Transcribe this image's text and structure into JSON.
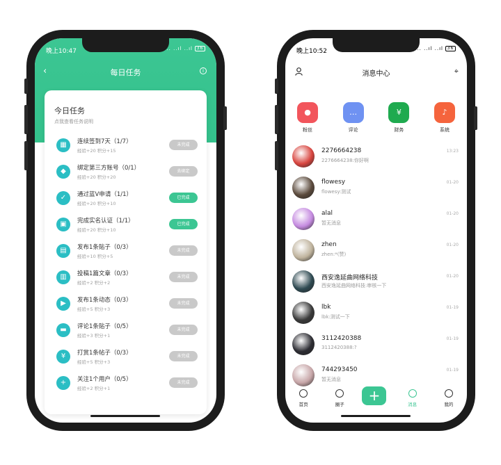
{
  "left": {
    "status_time": "晚上10:47",
    "status_icons": "... ..ıl ..ıl",
    "battery": "36",
    "nav": {
      "back": "‹",
      "title": "每日任务",
      "info": "i"
    },
    "card": {
      "title": "今日任务",
      "subtitle": "点我查看任务说明"
    },
    "tasks": [
      {
        "icon": "▦",
        "name": "连续签到7天（1/7）",
        "reward": "经验+20   积分+15",
        "status": "未完成",
        "done": false
      },
      {
        "icon": "◆",
        "name": "绑定第三方账号（0/1）",
        "reward": "经验+20   积分+20",
        "status": "去绑定",
        "done": false
      },
      {
        "icon": "✓",
        "name": "通过蓝V申请（1/1）",
        "reward": "经验+20   积分+10",
        "status": "已完成",
        "done": true
      },
      {
        "icon": "▣",
        "name": "完成实名认证（1/1）",
        "reward": "经验+20   积分+10",
        "status": "已完成",
        "done": true
      },
      {
        "icon": "▤",
        "name": "发布1条贴子（0/3）",
        "reward": "经验+10   积分+5",
        "status": "未完成",
        "done": false
      },
      {
        "icon": "▥",
        "name": "投稿1篇文章（0/3）",
        "reward": "经验+2   积分+2",
        "status": "未完成",
        "done": false
      },
      {
        "icon": "▶",
        "name": "发布1条动态（0/3）",
        "reward": "经验+5   积分+3",
        "status": "未完成",
        "done": false
      },
      {
        "icon": "▬",
        "name": "评论1条贴子（0/5）",
        "reward": "经验+3   积分+1",
        "status": "未完成",
        "done": false
      },
      {
        "icon": "¥",
        "name": "打赏1条帖子（0/3）",
        "reward": "经验+5   积分+3",
        "status": "未完成",
        "done": false
      },
      {
        "icon": "+",
        "name": "关注1个用户（0/5）",
        "reward": "经验+2   积分+1",
        "status": "未完成",
        "done": false
      }
    ],
    "colors": {
      "accent": "#3cc693",
      "task_icon": "#2bbec4",
      "button_gray": "#c9c9c9"
    }
  },
  "right": {
    "status_time": "晚上10:52",
    "status_icons": "... ..ıl ..ıl",
    "battery": "36",
    "title": "消息中心",
    "categories": [
      {
        "label": "粉丝",
        "icon": "person-icon",
        "glyph": "●",
        "color": "#f2555c"
      },
      {
        "label": "评论",
        "icon": "comment-icon",
        "glyph": "…",
        "color": "#6f92f2"
      },
      {
        "label": "财务",
        "icon": "money-icon",
        "glyph": "¥",
        "color": "#1faa4f"
      },
      {
        "label": "系统",
        "icon": "bell-icon",
        "glyph": "♪",
        "color": "#f5643d"
      }
    ],
    "messages": [
      {
        "name": "2276664238",
        "preview": "2276664238:你好啊",
        "time": "13:23",
        "avatar_color": "#d8453f"
      },
      {
        "name": "flowesy",
        "preview": "flowesy:测试",
        "time": "01-20",
        "avatar_color": "#5b4a3c"
      },
      {
        "name": "alal",
        "preview": "暂无消息",
        "time": "01-20",
        "avatar_color": "#c58be0"
      },
      {
        "name": "zhen",
        "preview": "zhen:*(赞)",
        "time": "01-20",
        "avatar_color": "#bfb39d"
      },
      {
        "name": "西安逸延曲网络科技",
        "preview": "西安逸延曲网络科技:审核一下",
        "time": "01-20",
        "avatar_color": "#2f4a52"
      },
      {
        "name": "lbk",
        "preview": "lbk:测试一下",
        "time": "01-19",
        "avatar_color": "#3a3a3a"
      },
      {
        "name": "3112420388",
        "preview": "3112420388:?",
        "time": "01-19",
        "avatar_color": "#2d2d33"
      },
      {
        "name": "744293450",
        "preview": "暂无消息",
        "time": "01-19",
        "avatar_color": "#c7a6a8"
      }
    ],
    "tabs": [
      {
        "label": "首页",
        "icon": "home-icon",
        "active": false
      },
      {
        "label": "圈子",
        "icon": "compass-icon",
        "active": false
      },
      {
        "label": "",
        "icon": "plus-icon",
        "active": false,
        "plus": true
      },
      {
        "label": "消息",
        "icon": "message-icon",
        "active": true
      },
      {
        "label": "我的",
        "icon": "profile-icon",
        "active": false
      }
    ],
    "plus_glyph": "+"
  }
}
